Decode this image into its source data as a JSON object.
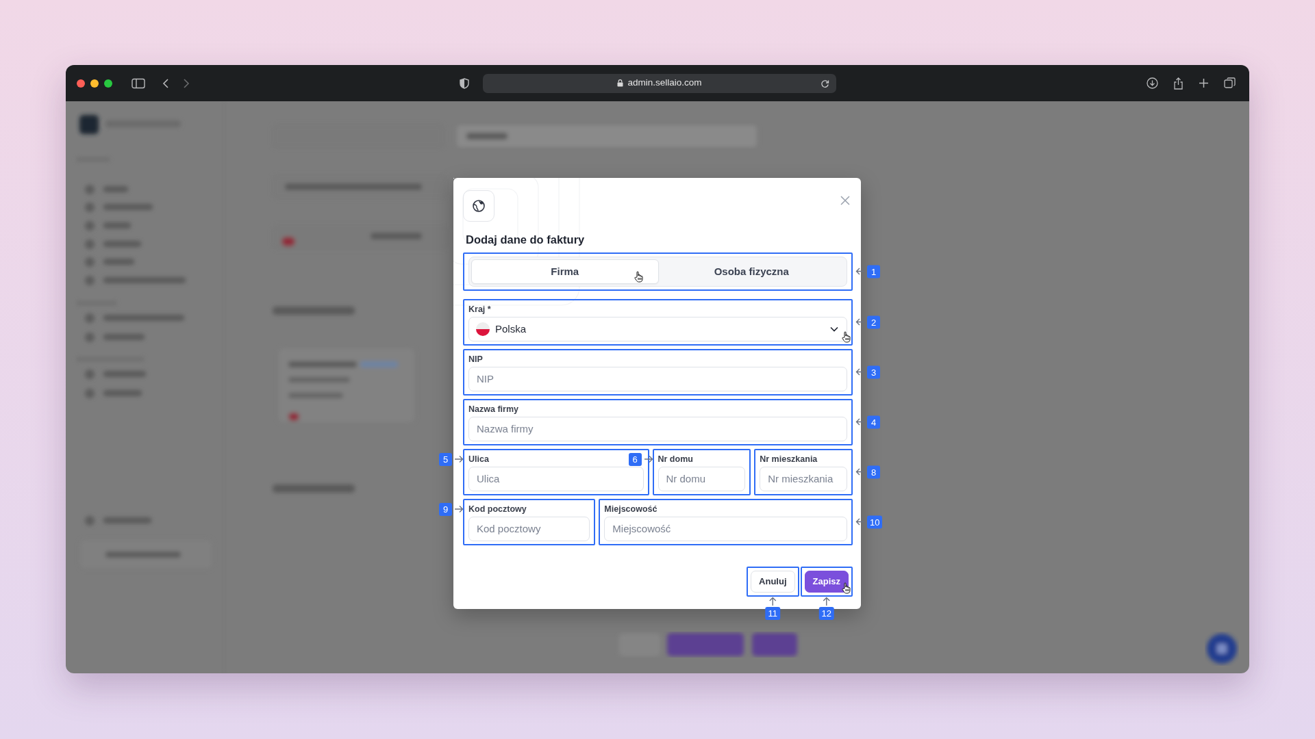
{
  "browser": {
    "url": "admin.sellaio.com"
  },
  "dialog": {
    "title": "Dodaj dane do faktury",
    "tabs_marker": {
      "number": "1",
      "kind": "right"
    },
    "tabs": [
      {
        "label": "Firma",
        "selected": true
      },
      {
        "label": "Osoba fizyczna",
        "selected": false
      }
    ],
    "field_rows": [
      [
        {
          "kind": "select",
          "label": "Kraj *",
          "value": "Polska",
          "marker": {
            "number": "2",
            "kind": "right"
          }
        }
      ],
      [
        {
          "kind": "text",
          "label": "NIP",
          "placeholder": "NIP",
          "marker": {
            "number": "3",
            "kind": "right"
          }
        }
      ],
      [
        {
          "kind": "text",
          "label": "Nazwa firmy",
          "placeholder": "Nazwa firmy",
          "marker": {
            "number": "4",
            "kind": "right"
          }
        }
      ],
      [
        {
          "kind": "text",
          "label": "Ulica",
          "placeholder": "Ulica",
          "marker": {
            "number": "5",
            "kind": "left"
          }
        },
        {
          "kind": "text",
          "label": "Nr domu",
          "placeholder": "Nr domu",
          "marker": {
            "number": "6",
            "kind": "left"
          }
        },
        {
          "kind": "text",
          "label": "Nr mieszkania",
          "placeholder": "Nr mieszkania",
          "marker": {
            "number": "8",
            "kind": "right"
          }
        }
      ],
      [
        {
          "kind": "text",
          "label": "Kod pocztowy",
          "placeholder": "Kod pocztowy",
          "marker": {
            "number": "9",
            "kind": "left"
          }
        },
        {
          "kind": "text",
          "label": "Miejscowość",
          "placeholder": "Miejscowość",
          "marker": {
            "number": "10",
            "kind": "right"
          }
        }
      ]
    ],
    "buttons": [
      {
        "kind": "secondary",
        "label": "Anuluj",
        "marker": {
          "number": "11",
          "kind": "below"
        }
      },
      {
        "kind": "primary",
        "label": "Zapisz",
        "marker": {
          "number": "12",
          "kind": "below"
        }
      }
    ]
  }
}
